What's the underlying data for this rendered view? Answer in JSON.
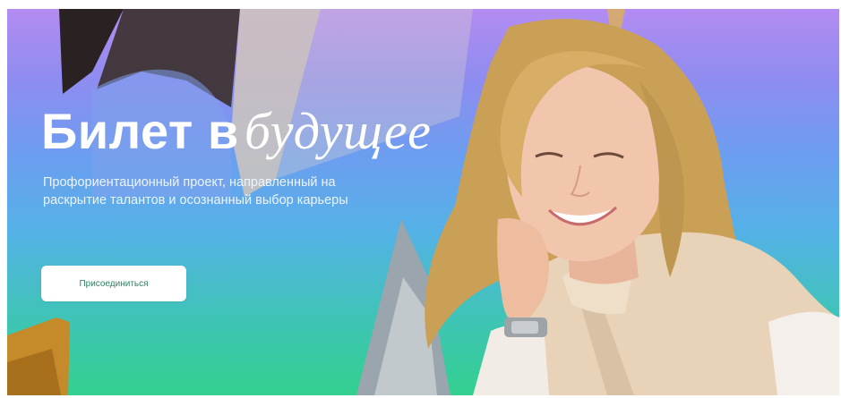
{
  "hero": {
    "title_plain": "Билет в",
    "title_italic": "будущее",
    "subtitle": "Профориентационный проект, направленный на раскрытие талантов и осознанный выбор карьеры",
    "button_label": "Присоединиться"
  },
  "colors": {
    "gradient_top": "#b38cf2",
    "gradient_middle": "#54b2e6",
    "gradient_bottom": "#33d08f",
    "button_text": "#2f7f63"
  }
}
